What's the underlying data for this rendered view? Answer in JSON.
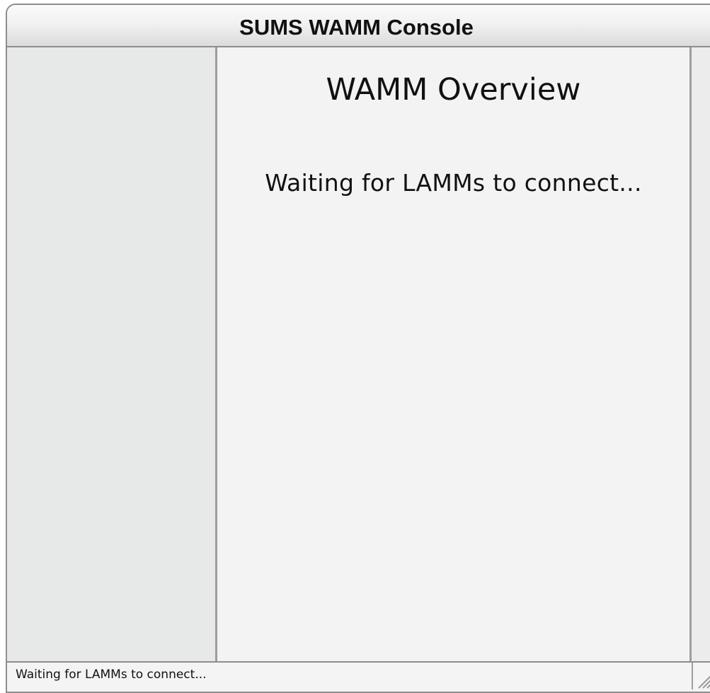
{
  "window": {
    "title": "SUMS WAMM Console"
  },
  "main": {
    "heading": "WAMM Overview",
    "message": "Waiting for LAMMs to connect..."
  },
  "statusbar": {
    "text": "Waiting for LAMMs to connect..."
  },
  "icons": {
    "resize_grip": "resize-grip-icon"
  }
}
